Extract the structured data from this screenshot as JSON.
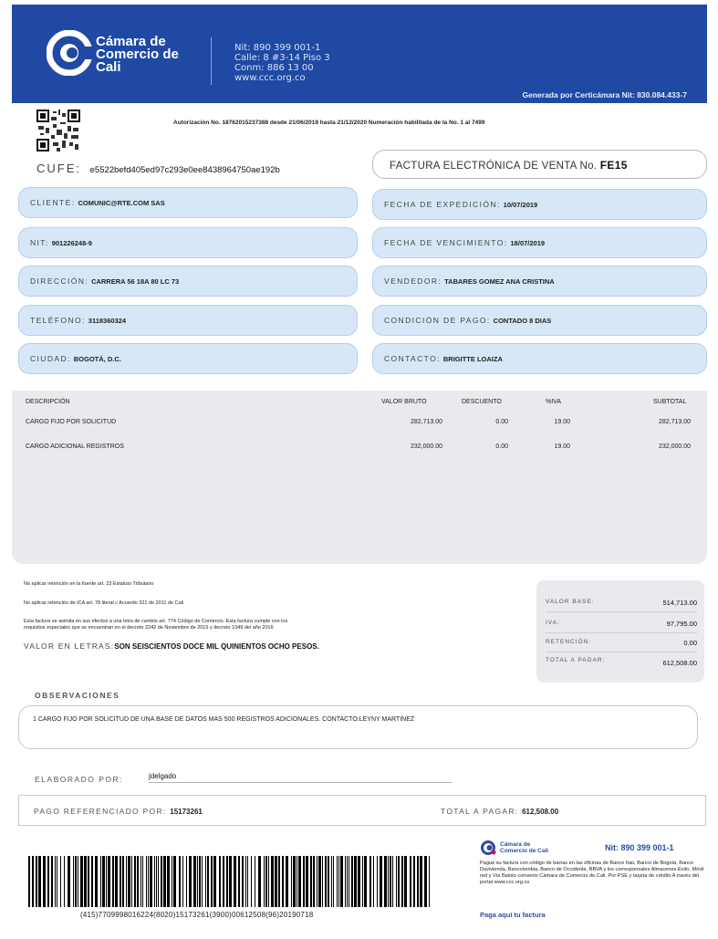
{
  "header": {
    "brand_line1": "Cámara de",
    "brand_line2": "Comercio de",
    "brand_line3": "Cali",
    "info_nit": "Nit: 890 399 001-1",
    "info_address": "Calle: 8 #3-14 Piso 3",
    "info_phone": "Conm: 886 13 00",
    "info_web": "www.ccc.org.co",
    "generated_by": "Generada por Certicámara Nit: 830.084.433-7"
  },
  "authorization": "Autorización No. 18762015237388 desde 21/06/2019 hasta 21/12/2020 Numeración habilitada de la No. 1 al 7499",
  "cufe": {
    "label": "CUFE:",
    "value": "e5522befd405ed97c293e0ee8438964750ae192b"
  },
  "invoice": {
    "title": "FACTURA ELECTRÓNICA DE VENTA No.",
    "number": "FE15"
  },
  "fields": {
    "cliente": {
      "label": "CLIENTE:",
      "value": "COMUNIC@RTE.COM SAS"
    },
    "nit": {
      "label": "NIT:",
      "value": "901226248-9"
    },
    "direccion": {
      "label": "DIRECCIÓN:",
      "value": "CARRERA 56 18A 80 LC 73"
    },
    "telefono": {
      "label": "TELÉFONO:",
      "value": "3118360324"
    },
    "ciudad": {
      "label": "CIUDAD:",
      "value": "BOGOTÁ, D.C."
    },
    "fecha_expedicion": {
      "label": "FECHA DE EXPEDICIÓN:",
      "value": "10/07/2019"
    },
    "fecha_vencimiento": {
      "label": "FECHA DE VENCIMIENTO:",
      "value": "18/07/2019"
    },
    "vendedor": {
      "label": "VENDEDOR:",
      "value": "TABARES GOMEZ ANA CRISTINA"
    },
    "condicion_pago": {
      "label": "CONDICIÓN DE PAGO:",
      "value": "CONTADO 8 DIAS"
    },
    "contacto": {
      "label": "CONTACTO:",
      "value": "BRIGITTE LOAIZA"
    }
  },
  "items": {
    "headers": [
      "DESCRIPCIÓN",
      "VALOR BRUTO",
      "DESCUENTO",
      "%IVA",
      "SUBTOTAL"
    ],
    "rows": [
      {
        "descripcion": "CARGO FIJO POR SOLICITUD",
        "valor_bruto": "282,713.00",
        "descuento": "0.00",
        "iva": "19.00",
        "subtotal": "282,713.00"
      },
      {
        "descripcion": "CARGO ADICIONAL REGISTROS",
        "valor_bruto": "232,000.00",
        "descuento": "0.00",
        "iva": "19.00",
        "subtotal": "232,000.00"
      }
    ]
  },
  "notes": {
    "retencion_fuente": "No aplicar retención en la fuente art. 23 Estatuto Tributario",
    "retencion_ica": "No aplicar retención de ICA art. 78 literal c Acuerdo 321 de 2011 de Cali",
    "letra_cambio_1": "Esta factura se asimila en sus efectos a una letra de cambio art. 774 Código de Comercio. Esta factura cumple con los",
    "letra_cambio_2": "requisitos especiales que se encuentran en el decreto 2242 de Noviembre de 2015 y decreto 1349 del año 2016"
  },
  "value_letters": {
    "label": "VALOR EN LETRAS:",
    "value": "SON SEISCIENTOS DOCE MIL QUINIENTOS OCHO PESOS."
  },
  "totals": {
    "valor_base_label": "VALOR BASE:",
    "valor_base": "514,713.00",
    "iva_label": "IVA:",
    "iva": "97,795.00",
    "retencion_label": "RETENCIÓN:",
    "retencion": "0.00",
    "total_label": "TOTAL A PAGAR:",
    "total": "612,508.00"
  },
  "observaciones": {
    "title": "OBSERVACIONES",
    "text": "1 CARGO FIJO POR SOLICITUD DE UNA BASE DE DATOS MAS 500 REGISTROS ADICIONALES. CONTACTO:LEYNY MARTINEZ"
  },
  "elaborado": {
    "label": "ELABORADO POR:",
    "value": "jdelgado"
  },
  "pago": {
    "label": "PAGO REFERENCIADO POR:",
    "value": "15173261",
    "total_label": "TOTAL A PAGAR:",
    "total": "612,508.00"
  },
  "barcode_text": "(415)7709998016224(8020)15173261(3900)00612508(96)20190718",
  "bottom": {
    "brand_line1": "Cámara de",
    "brand_line2": "Comercio de Cali",
    "nit": "Nit: 890 399 001-1",
    "payinfo": "Pague su factura con código de barras en las oficinas de Banco Itaú, Banco de Bogotá, Banco Davivienda, Bancolombia, Banco de Occidente, BBVA y los corresponsales Almacenes Éxito, Móvil red y Vía Baloto convenio Cámara de Comercio de Cali. Por PSE y tarjeta de crédito A través del portal www.ccc.org.co",
    "paylink": "Paga aquí tu factura"
  },
  "colors": {
    "header_blue": "#1f49a3",
    "field_bg": "#d7e7f8",
    "panel_gray": "#e9eaee",
    "brand_blue": "#2b4ea3"
  }
}
